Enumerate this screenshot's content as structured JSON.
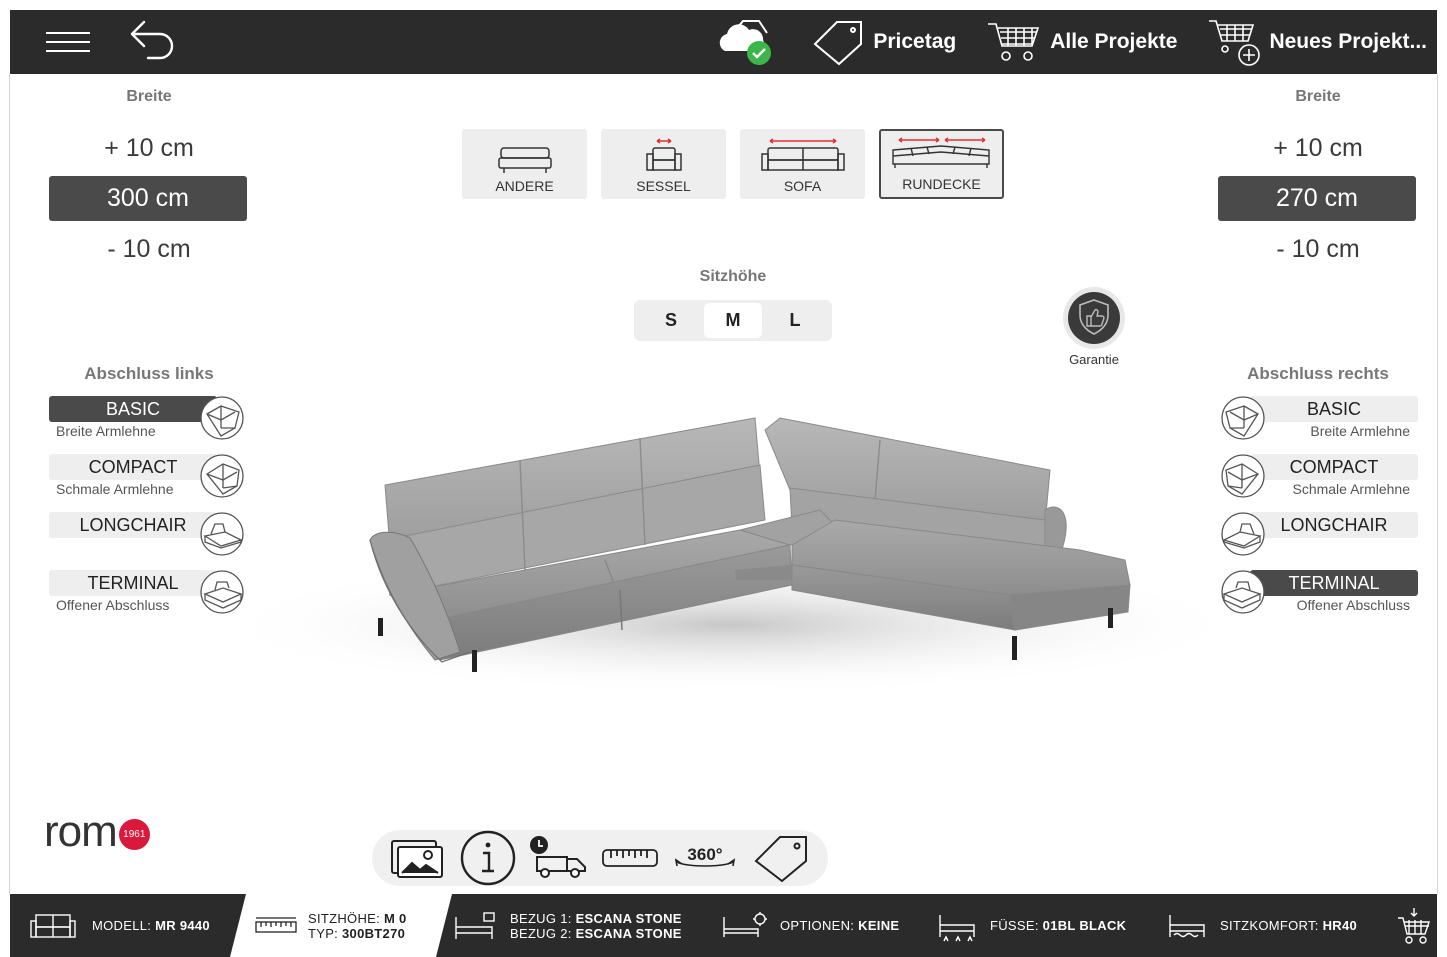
{
  "topbar": {
    "pricetag_label": "Pricetag",
    "alle_projekte_label": "Alle Projekte",
    "neues_projekt_label": "Neues Projekt..."
  },
  "width_left": {
    "header": "Breite",
    "plus": "+ 10 cm",
    "value": "300 cm",
    "minus": "- 10 cm"
  },
  "width_right": {
    "header": "Breite",
    "plus": "+ 10 cm",
    "value": "270 cm",
    "minus": "- 10 cm"
  },
  "types": [
    {
      "label": "ANDERE",
      "icon": "bench-icon"
    },
    {
      "label": "SESSEL",
      "icon": "armchair-icon"
    },
    {
      "label": "SOFA",
      "icon": "sofa-icon"
    },
    {
      "label": "RUNDECKE",
      "icon": "corner-sofa-icon",
      "active": true
    }
  ],
  "sitzhoehe": {
    "title": "Sitzhöhe",
    "options": [
      "S",
      "M",
      "L"
    ],
    "selected": "M"
  },
  "garantie": {
    "label": "Garantie"
  },
  "ends_left": {
    "header": "Abschluss links",
    "items": [
      {
        "label": "BASIC",
        "sub": "Breite Armlehne",
        "active": true
      },
      {
        "label": "COMPACT",
        "sub": "Schmale Armlehne"
      },
      {
        "label": "LONGCHAIR",
        "sub": ""
      },
      {
        "label": "TERMINAL",
        "sub": "Offener Abschluss"
      }
    ]
  },
  "ends_right": {
    "header": "Abschluss rechts",
    "items": [
      {
        "label": "BASIC",
        "sub": "Breite Armlehne"
      },
      {
        "label": "COMPACT",
        "sub": "Schmale Armlehne"
      },
      {
        "label": "LONGCHAIR",
        "sub": ""
      },
      {
        "label": "TERMINAL",
        "sub": "Offener Abschluss",
        "active": true
      }
    ]
  },
  "logo": {
    "word": "rom",
    "badge": "1961"
  },
  "tools": {
    "rotate_label": "360°"
  },
  "statusbar": {
    "modell_key": "MODELL: ",
    "modell_val": "MR 9440",
    "sitzhoehe_key": "SITZHÖHE: ",
    "sitzhoehe_val": "M 0",
    "typ_key": "TYP: ",
    "typ_val": "300BT270",
    "bezug1_key": "BEZUG 1: ",
    "bezug1_val": "ESCANA STONE",
    "bezug2_key": "BEZUG 2: ",
    "bezug2_val": "ESCANA STONE",
    "optionen_key": "OPTIONEN: ",
    "optionen_val": "KEINE",
    "fuesse_key": "FÜSSE: ",
    "fuesse_val": "01BL BLACK",
    "sitzkomfort_key": "SITZKOMFORT: ",
    "sitzkomfort_val": "HR40"
  },
  "colors": {
    "bar_dark": "#2b2b2b",
    "active_gray": "#4a4a4a",
    "brand_red": "#d9183b",
    "cloud_ok_green": "#3cb54a",
    "dimension_red": "#e03131"
  }
}
